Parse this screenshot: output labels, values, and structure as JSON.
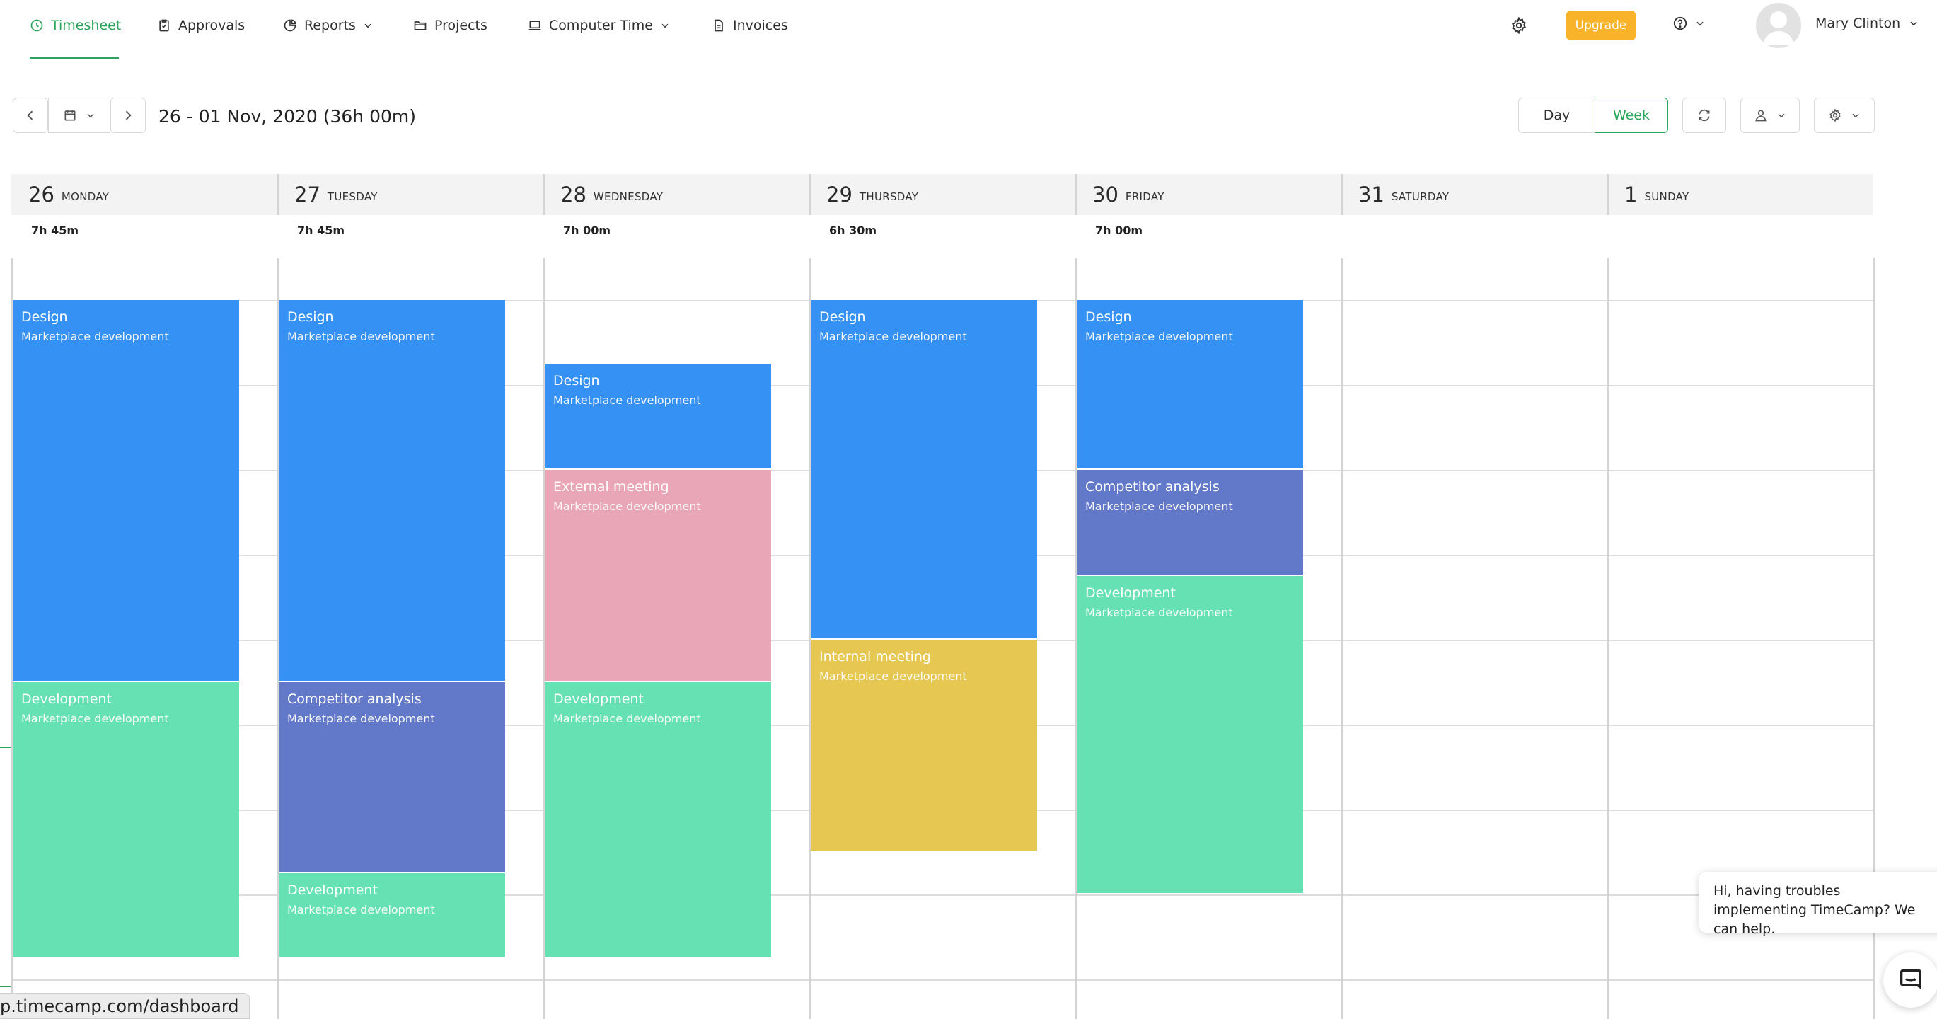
{
  "nav": {
    "items": [
      {
        "label": "Timesheet",
        "icon": "clock-icon",
        "active": true
      },
      {
        "label": "Approvals",
        "icon": "clipboard-check-icon"
      },
      {
        "label": "Reports",
        "icon": "pie-chart-icon",
        "dropdown": true
      },
      {
        "label": "Projects",
        "icon": "folder-icon"
      },
      {
        "label": "Computer Time",
        "icon": "laptop-icon",
        "dropdown": true
      },
      {
        "label": "Invoices",
        "icon": "document-icon"
      }
    ],
    "upgrade_label": "Upgrade",
    "user_name": "Mary Clinton"
  },
  "toolbar": {
    "date_range": "26 - 01 Nov, 2020 (36h 00m)",
    "view_day": "Day",
    "view_week": "Week"
  },
  "days": [
    {
      "num": "26",
      "name": "MONDAY",
      "total": "7h 45m"
    },
    {
      "num": "27",
      "name": "TUESDAY",
      "total": "7h 45m"
    },
    {
      "num": "28",
      "name": "WEDNESDAY",
      "total": "7h 00m"
    },
    {
      "num": "29",
      "name": "THURSDAY",
      "total": "6h 30m"
    },
    {
      "num": "30",
      "name": "FRIDAY",
      "total": "7h 00m"
    },
    {
      "num": "31",
      "name": "SATURDAY",
      "total": ""
    },
    {
      "num": "1",
      "name": "SUNDAY",
      "total": ""
    }
  ],
  "events": [
    {
      "day": 0,
      "title": "Design",
      "subtitle": "Marketplace development",
      "color": "#3591f3",
      "start": "9:00",
      "end": "13:30"
    },
    {
      "day": 0,
      "title": "Development",
      "subtitle": "Marketplace development",
      "color": "#66e1b4",
      "start": "13:30",
      "end": "16:45"
    },
    {
      "day": 1,
      "title": "Design",
      "subtitle": "Marketplace development",
      "color": "#3591f3",
      "start": "9:00",
      "end": "13:30"
    },
    {
      "day": 1,
      "title": "Competitor analysis",
      "subtitle": "Marketplace development",
      "color": "#6278c8",
      "start": "13:30",
      "end": "15:45"
    },
    {
      "day": 1,
      "title": "Development",
      "subtitle": "Marketplace development",
      "color": "#66e1b4",
      "start": "15:45",
      "end": "16:45"
    },
    {
      "day": 2,
      "title": "Design",
      "subtitle": "Marketplace development",
      "color": "#3591f3",
      "start": "9:45",
      "end": "11:00"
    },
    {
      "day": 2,
      "title": "External meeting",
      "subtitle": "Marketplace development",
      "color": "#e9a6b6",
      "start": "11:00",
      "end": "13:30"
    },
    {
      "day": 2,
      "title": "Development",
      "subtitle": "Marketplace development",
      "color": "#66e1b4",
      "start": "13:30",
      "end": "16:45"
    },
    {
      "day": 3,
      "title": "Design",
      "subtitle": "Marketplace development",
      "color": "#3591f3",
      "start": "9:00",
      "end": "13:00"
    },
    {
      "day": 3,
      "title": "Internal meeting",
      "subtitle": "Marketplace development",
      "color": "#e5c752",
      "start": "13:00",
      "end": "15:30"
    },
    {
      "day": 4,
      "title": "Design",
      "subtitle": "Marketplace development",
      "color": "#3591f3",
      "start": "9:00",
      "end": "11:00"
    },
    {
      "day": 4,
      "title": "Competitor analysis",
      "subtitle": "Marketplace development",
      "color": "#6278c8",
      "start": "11:00",
      "end": "12:15"
    },
    {
      "day": 4,
      "title": "Development",
      "subtitle": "Marketplace development",
      "color": "#66e1b4",
      "start": "12:15",
      "end": "16:00"
    }
  ],
  "chat": {
    "message": "Hi, having troubles implementing TimeCamp? We can help."
  },
  "status_url": "p.timecamp.com/dashboard"
}
